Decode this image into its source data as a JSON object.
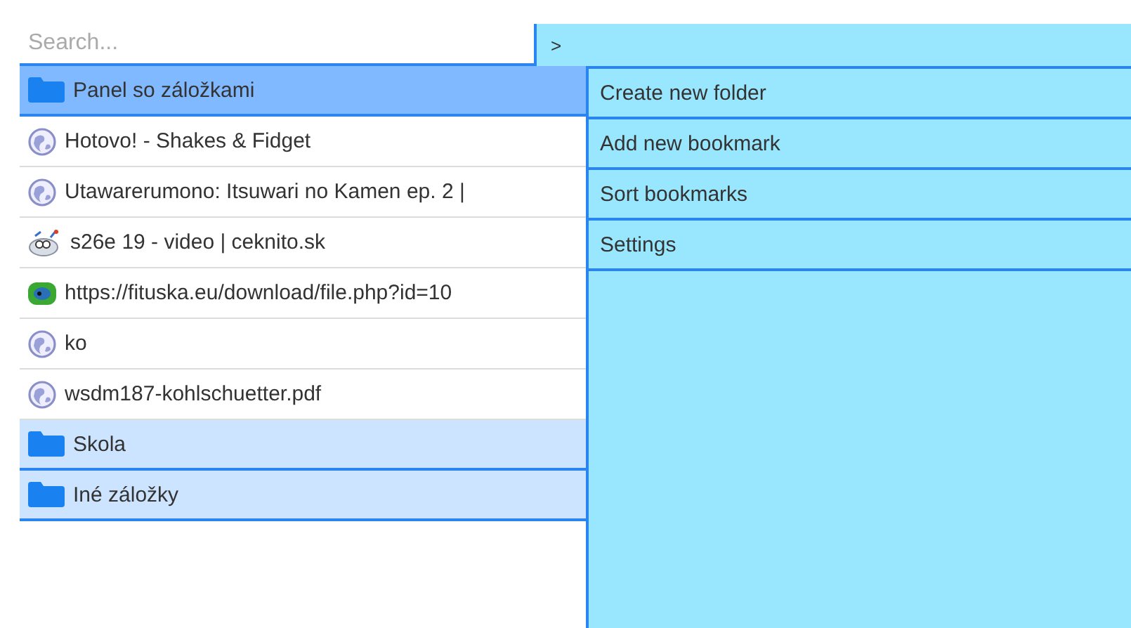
{
  "search": {
    "placeholder": "Search..."
  },
  "path_bar": {
    "text": ">"
  },
  "bookmarks": [
    {
      "kind": "folder",
      "label": "Panel so záložkami",
      "selected": true
    },
    {
      "kind": "page",
      "label": "Hotovo! - Shakes & Fidget",
      "selected": false
    },
    {
      "kind": "page",
      "label": "Utawarerumono: Itsuwari no Kamen ep. 2 |",
      "selected": false
    },
    {
      "kind": "site",
      "label": "s26e 19 - video | ceknito.sk",
      "selected": false
    },
    {
      "kind": "site",
      "label": "https://fituska.eu/download/file.php?id=10",
      "selected": false
    },
    {
      "kind": "page",
      "label": "ko",
      "selected": false
    },
    {
      "kind": "page",
      "label": "wsdm187-kohlschuetter.pdf",
      "selected": false
    },
    {
      "kind": "folder",
      "label": "Skola",
      "selected": false
    },
    {
      "kind": "folder",
      "label": "Iné záložky",
      "selected": false
    }
  ],
  "menu": [
    "Create new folder",
    "Add new bookmark",
    "Sort bookmarks",
    "Settings"
  ]
}
